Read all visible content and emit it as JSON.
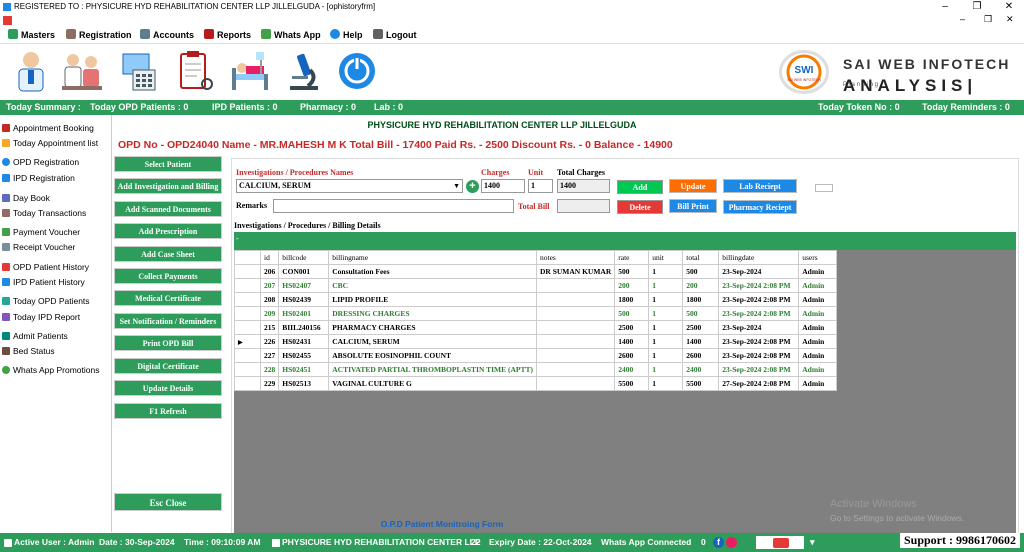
{
  "window": {
    "title": "REGISTERED TO : PHYSICURE HYD REHABILITATION CENTER LLP JILLELGUDA - [ophistoryfrm]",
    "controls": [
      "–",
      "❐",
      "✕"
    ],
    "mdi_controls": [
      "–",
      "❐",
      "✕"
    ]
  },
  "menubar": {
    "items": [
      {
        "label": "Masters",
        "icon": "plus-icon"
      },
      {
        "label": "Registration",
        "icon": "registration-icon"
      },
      {
        "label": "Accounts",
        "icon": "accounts-icon"
      },
      {
        "label": "Reports",
        "icon": "reports-icon"
      },
      {
        "label": "Whats App",
        "icon": "whatsapp-icon"
      },
      {
        "label": "Help",
        "icon": "help-icon"
      },
      {
        "label": "Logout",
        "icon": "logout-icon"
      }
    ]
  },
  "brand": {
    "name": "SAI WEB INFOTECH",
    "tagline": "ANALYSIS|",
    "small": "P l a n n i n g",
    "logo_text": "SWI",
    "logo_sub": "SAI WEB INFOTECH"
  },
  "summary": {
    "today_summary": "Today Summary :",
    "opd": "Today OPD Patients : 0",
    "ipd": "IPD Patients : 0",
    "pharmacy": "Pharmacy : 0",
    "lab": "Lab : 0",
    "token": "Today Token No : 0",
    "reminders": "Today Reminders : 0"
  },
  "sidebar": {
    "items": [
      "Appointment Booking",
      "Today Appointment list",
      "OPD Registration",
      "IPD Registration",
      "Day Book",
      "Today Transactions",
      "Payment Voucher",
      "Receipt Voucher",
      "OPD Patient History",
      "IPD Patient History",
      "Today OPD Patients",
      "Today IPD Report",
      "Admit Patients",
      "Bed Status",
      "Whats App Promotions"
    ]
  },
  "main": {
    "company": "PHYSICURE HYD REHABILITATION CENTER LLP JILLELGUDA",
    "opd_line": "OPD No - OPD24040  Name - MR.MAHESH M K   Total Bill - 17400  Paid Rs. - 2500  Discount Rs. - 0  Balance - 14900",
    "left_buttons": [
      "Select Patient",
      "Add Investigation and Billing",
      "Add Scanned Documents",
      "Add Prescription",
      "Add Case Sheet",
      "Collect Payments",
      "Medical Certificate",
      "Set Notification / Reminders",
      "Print OPD Bill",
      "Digital Certificate",
      "Update Details",
      "F1 Refresh"
    ],
    "esc_close": "Esc Close",
    "footer_title": "O.P.D Patient Monitroing Form"
  },
  "form": {
    "inv_label": "Investigations / Procedures Names",
    "inv_value": "CALCIUM, SERUM",
    "charges_label": "Charges",
    "charges_value": "1400",
    "unit_label": "Unit",
    "unit_value": "1",
    "total_charges_label": "Total Charges",
    "total_charges_value": "1400",
    "remarks_label": "Remarks",
    "remarks_value": "",
    "total_bill_label": "Total Bill",
    "total_bill_value": "",
    "details_label": "Investigations / Procedures / Billing Details",
    "grid_marker": "-",
    "buttons": {
      "add": "Add",
      "update": "Update",
      "lab_receipt": "Lab Reciept",
      "delete": "Delete",
      "bill_print": "Bill Print",
      "pharmacy_receipt": "Pharmacy Reciept"
    }
  },
  "grid": {
    "columns": [
      "id",
      "billcode",
      "billingname",
      "notes",
      "rate",
      "unit",
      "total",
      "billingdate",
      "users"
    ],
    "rows": [
      {
        "id": "206",
        "billcode": "CON001",
        "billingname": "Consultation Fees",
        "notes": "DR SUMAN KUMAR",
        "rate": "500",
        "unit": "1",
        "total": "500",
        "billingdate": "23-Sep-2024",
        "users": "Admin",
        "green": false,
        "current": false
      },
      {
        "id": "207",
        "billcode": "HS02407",
        "billingname": "CBC",
        "notes": "",
        "rate": "200",
        "unit": "1",
        "total": "200",
        "billingdate": "23-Sep-2024 2:08 PM",
        "users": "Admin",
        "green": true,
        "current": false
      },
      {
        "id": "208",
        "billcode": "HS02439",
        "billingname": "LIPID PROFILE",
        "notes": "",
        "rate": "1800",
        "unit": "1",
        "total": "1800",
        "billingdate": "23-Sep-2024 2:08 PM",
        "users": "Admin",
        "green": false,
        "current": false
      },
      {
        "id": "209",
        "billcode": "HS02401",
        "billingname": "DRESSING CHARGES",
        "notes": "",
        "rate": "500",
        "unit": "1",
        "total": "500",
        "billingdate": "23-Sep-2024 2:08 PM",
        "users": "Admin",
        "green": true,
        "current": false
      },
      {
        "id": "215",
        "billcode": "BIIL240156",
        "billingname": "PHARMACY CHARGES",
        "notes": "",
        "rate": "2500",
        "unit": "1",
        "total": "2500",
        "billingdate": "23-Sep-2024",
        "users": "Admin",
        "green": false,
        "current": false
      },
      {
        "id": "226",
        "billcode": "HS02431",
        "billingname": "CALCIUM, SERUM",
        "notes": "",
        "rate": "1400",
        "unit": "1",
        "total": "1400",
        "billingdate": "23-Sep-2024 2:08 PM",
        "users": "Admin",
        "green": false,
        "current": true
      },
      {
        "id": "227",
        "billcode": "HS02455",
        "billingname": "ABSOLUTE EOSINOPHIL COUNT",
        "notes": "",
        "rate": "2600",
        "unit": "1",
        "total": "2600",
        "billingdate": "23-Sep-2024 2:08 PM",
        "users": "Admin",
        "green": false,
        "current": false
      },
      {
        "id": "228",
        "billcode": "HS02451",
        "billingname": "ACTIVATED PARTIAL THROMBOPLASTIN TIME (APTT)",
        "notes": "",
        "rate": "2400",
        "unit": "1",
        "total": "2400",
        "billingdate": "23-Sep-2024 2:08 PM",
        "users": "Admin",
        "green": true,
        "current": false
      },
      {
        "id": "229",
        "billcode": "HS02513",
        "billingname": "VAGINAL CULTURE G",
        "notes": "",
        "rate": "5500",
        "unit": "1",
        "total": "5500",
        "billingdate": "27-Sep-2024 2:08 PM",
        "users": "Admin",
        "green": false,
        "current": false
      }
    ]
  },
  "watermark": {
    "title": "Activate Windows",
    "sub": "Go to Settings to activate Windows."
  },
  "status": {
    "active_user": "Active User :  Admin",
    "date": "Date :  30-Sep-2024",
    "time": "Time :  09:10:09 AM",
    "company": "PHYSICURE HYD REHABILITATION CENTER LLP",
    "num": "22",
    "expiry": "Expiry Date :  22-Oct-2024",
    "whatsapp": "Whats App Connected",
    "zero": "0",
    "support": "Support : 9986170602"
  },
  "colors": {
    "accent_green": "#2e9d5c",
    "opd_red": "#c62828",
    "link_blue": "#1565c0"
  }
}
